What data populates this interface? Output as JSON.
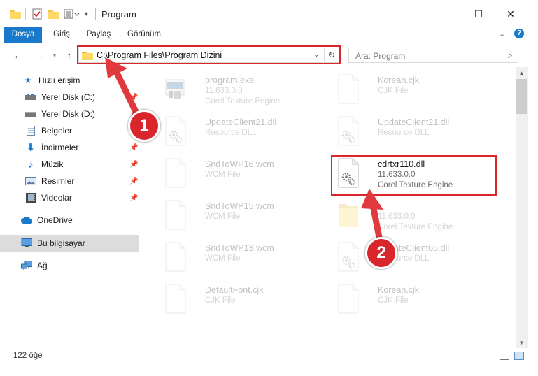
{
  "window": {
    "title": "Program",
    "controls": {
      "minimize": "—",
      "maximize": "☐",
      "close": "✕"
    }
  },
  "ribbon": {
    "tabs": [
      "Dosya",
      "Giriş",
      "Paylaş",
      "Görünüm"
    ],
    "help": "?"
  },
  "address": {
    "path": "C:\\Program Files\\Program Dizini",
    "search_placeholder": "Ara: Program"
  },
  "sidebar": {
    "items": [
      {
        "label": "Hızlı erişim",
        "icon": "star-icon",
        "pinned": false
      },
      {
        "label": "Yerel Disk (C:)",
        "icon": "drive-c-icon",
        "pinned": true
      },
      {
        "label": "Yerel Disk (D:)",
        "icon": "drive-d-icon",
        "pinned": true
      },
      {
        "label": "Belgeler",
        "icon": "documents-icon",
        "pinned": true
      },
      {
        "label": "İndirmeler",
        "icon": "downloads-icon",
        "pinned": true
      },
      {
        "label": "Müzik",
        "icon": "music-icon",
        "pinned": true
      },
      {
        "label": "Resimler",
        "icon": "pictures-icon",
        "pinned": true
      },
      {
        "label": "Videolar",
        "icon": "videos-icon",
        "pinned": true
      },
      {
        "label": "OneDrive",
        "icon": "onedrive-icon",
        "pinned": false
      },
      {
        "label": "Bu bilgisayar",
        "icon": "this-pc-icon",
        "pinned": false,
        "selected": true
      },
      {
        "label": "Ağ",
        "icon": "network-icon",
        "pinned": false
      }
    ]
  },
  "files": [
    {
      "name": "program.exe",
      "line2": "11.633.0.0",
      "line3": "Corel Texture Engine",
      "icon": "exe-icon",
      "faded": true
    },
    {
      "name": "Korean.cjk",
      "line2": "CJK File",
      "line3": "",
      "icon": "blank-file-icon",
      "faded": true
    },
    {
      "name": "UpdateClient21.dll",
      "line2": "Resource DLL",
      "line3": "",
      "icon": "dll-file-icon",
      "faded": true
    },
    {
      "name": "UpdateClient21.dll",
      "line2": "Resource DLL",
      "line3": "",
      "icon": "dll-file-icon",
      "faded": true
    },
    {
      "name": "SndToWP16.wcm",
      "line2": "WCM File",
      "line3": "",
      "icon": "blank-file-icon",
      "faded": true
    },
    {
      "name": "cdrtxr110.dll",
      "line2": "11.633.0.0",
      "line3": "Corel Texture Engine",
      "icon": "dll-file-icon",
      "faded": false
    },
    {
      "name": "SndToWP15.wcm",
      "line2": "WCM File",
      "line3": "",
      "icon": "blank-file-icon",
      "faded": true
    },
    {
      "name": "",
      "line2": "11.633.0.0",
      "line3": "Corel Texture Engine",
      "icon": "folder-file-icon",
      "faded": true
    },
    {
      "name": "SndToWP13.wcm",
      "line2": "WCM File",
      "line3": "",
      "icon": "blank-file-icon",
      "faded": true
    },
    {
      "name": "UpdateClient65.dll",
      "line2": "Resource DLL",
      "line3": "",
      "icon": "dll-file-icon",
      "faded": true
    },
    {
      "name": "DefaultFont.cjk",
      "line2": "CJK File",
      "line3": "",
      "icon": "blank-file-icon",
      "faded": true
    },
    {
      "name": "Korean.cjk",
      "line2": "CJK File",
      "line3": "",
      "icon": "blank-file-icon",
      "faded": true
    }
  ],
  "status": {
    "item_count": "122 öğe"
  },
  "callouts": {
    "first": "1",
    "second": "2"
  },
  "colors": {
    "accent": "#1979ca",
    "highlight": "#d9262c"
  }
}
